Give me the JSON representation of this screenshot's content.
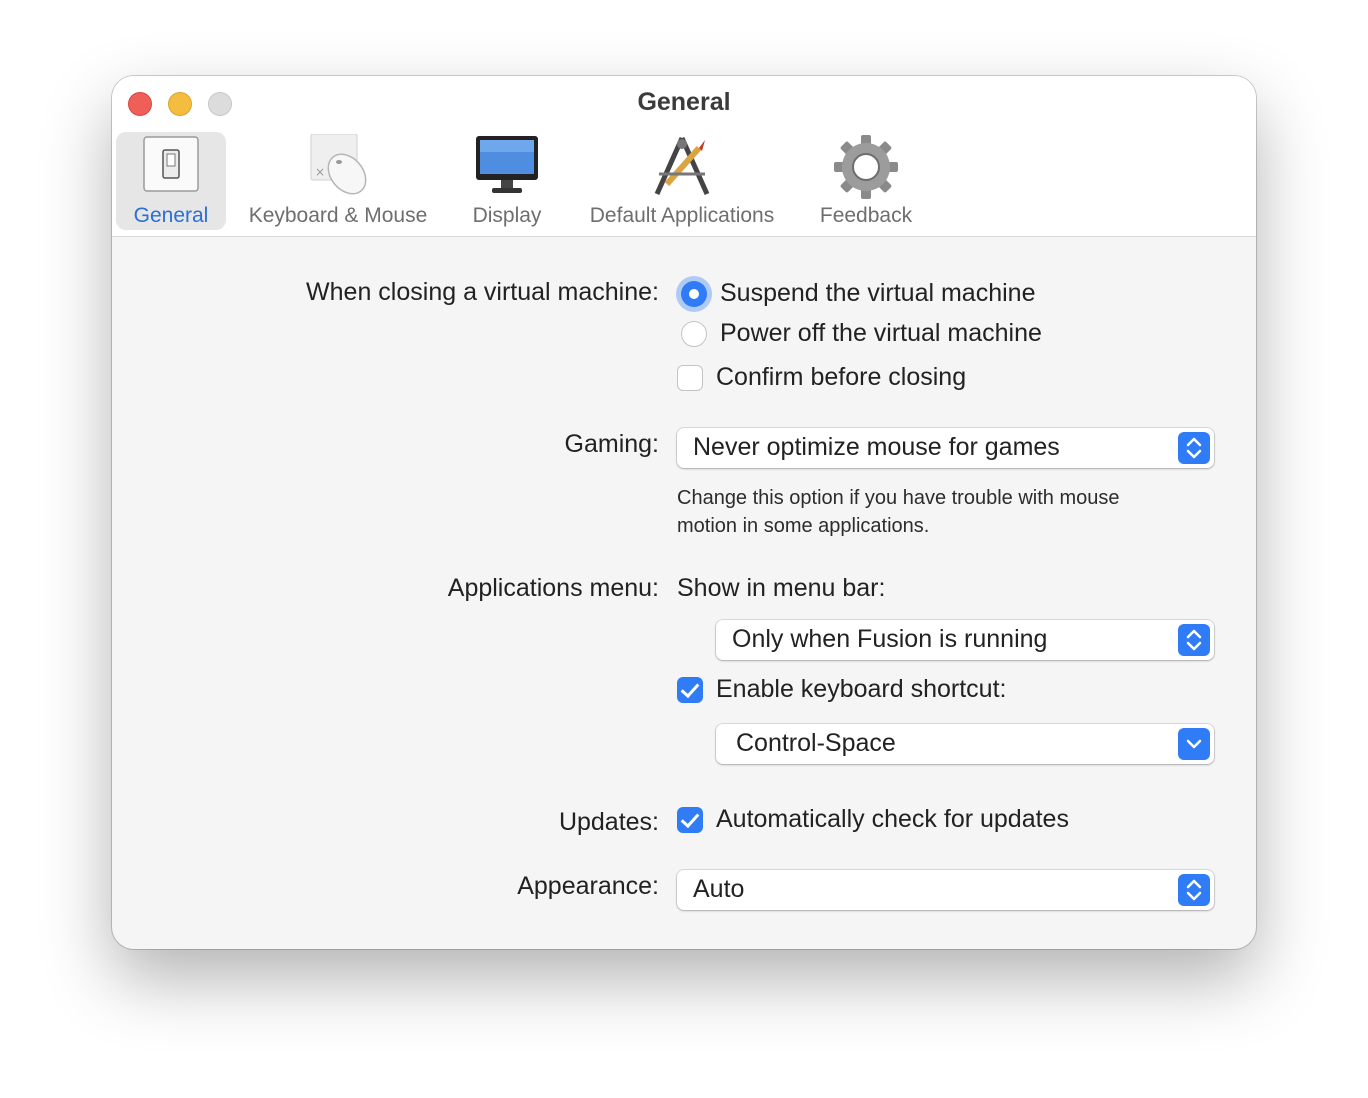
{
  "window": {
    "title": "General"
  },
  "toolbar": {
    "tabs": [
      {
        "label": "General",
        "icon": "switch-icon",
        "active": true
      },
      {
        "label": "Keyboard & Mouse",
        "icon": "mouse-icon",
        "active": false
      },
      {
        "label": "Display",
        "icon": "monitor-icon",
        "active": false
      },
      {
        "label": "Default Applications",
        "icon": "app-tools-icon",
        "active": false
      },
      {
        "label": "Feedback",
        "icon": "gear-icon",
        "active": false
      }
    ]
  },
  "closing": {
    "label": "When closing a virtual machine:",
    "suspend": {
      "label": "Suspend the virtual machine",
      "selected": true
    },
    "power_off": {
      "label": "Power off the virtual machine",
      "selected": false
    },
    "confirm": {
      "label": "Confirm before closing",
      "checked": false
    }
  },
  "gaming": {
    "label": "Gaming:",
    "value": "Never optimize mouse for games",
    "hint_line1": "Change this option if you have trouble with mouse",
    "hint_line2": "motion in some applications."
  },
  "applications_menu": {
    "label": "Applications menu:",
    "show_label": "Show in menu bar:",
    "show_value": "Only when Fusion is running",
    "shortcut_enable": {
      "label": "Enable keyboard shortcut:",
      "checked": true
    },
    "shortcut_value": "Control-Space"
  },
  "updates": {
    "label": "Updates:",
    "auto_check": {
      "label": "Automatically check for updates",
      "checked": true
    }
  },
  "appearance": {
    "label": "Appearance:",
    "value": "Auto"
  },
  "colors": {
    "accent": "#2f7cf6",
    "active_tab_label": "#2a6fd6",
    "close": "#ed5f57",
    "minimize": "#f5bd40",
    "zoom": "#dcdcdc"
  }
}
